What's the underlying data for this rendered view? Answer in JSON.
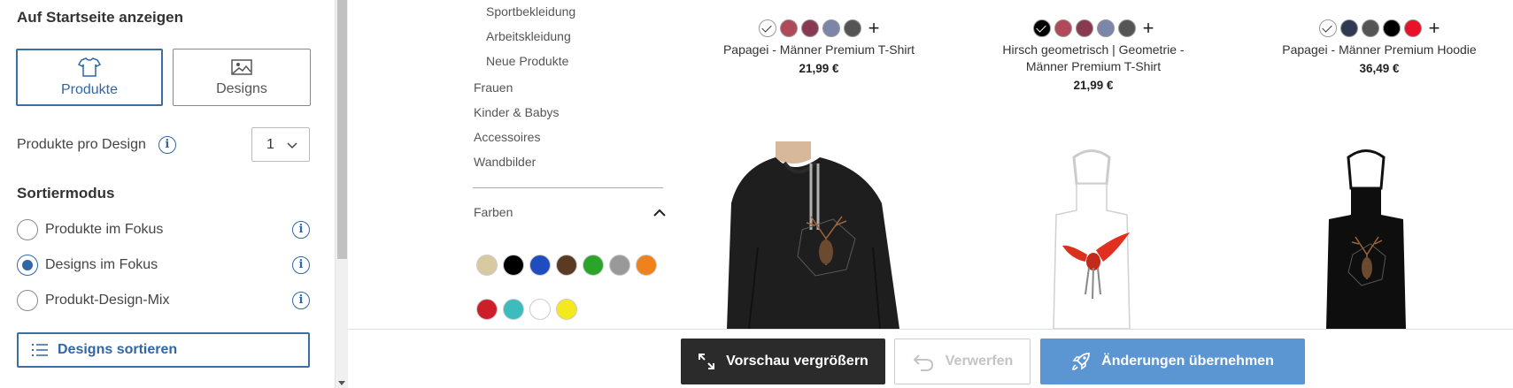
{
  "left": {
    "heading_home": "Auf Startseite anzeigen",
    "toggle": [
      {
        "label": "Produkte",
        "icon": "tshirt-icon",
        "active": true
      },
      {
        "label": "Designs",
        "icon": "image-icon",
        "active": false
      }
    ],
    "products_per_design_label": "Produkte pro Design",
    "products_per_design_value": "1",
    "sort_heading": "Sortiermodus",
    "sort_options": [
      {
        "label": "Produkte im Fokus",
        "selected": false
      },
      {
        "label": "Designs im Fokus",
        "selected": true
      },
      {
        "label": "Produkt-Design-Mix",
        "selected": false
      }
    ],
    "sort_button": "Designs sortieren"
  },
  "categories": {
    "sub": [
      "Sportbekleidung",
      "Arbeitskleidung",
      "Neue Produkte"
    ],
    "main": [
      "Frauen",
      "Kinder & Babys",
      "Accessoires",
      "Wandbilder"
    ],
    "colors_label": "Farben",
    "color_swatches": [
      "#d9c9a0",
      "#000000",
      "#1f4cbf",
      "#5a3a22",
      "#2aa52a",
      "#999999",
      "#f0821e",
      "#cc1f2a",
      "#3cbcbc",
      "#ffffff",
      "#f4e81f"
    ]
  },
  "products": [
    {
      "name": "Papagei - Männer Premium T-Shirt",
      "price": "21,99 €",
      "colors": [
        "#ffffff",
        "#b04a5a",
        "#8a3a50",
        "#7b86aa",
        "#555555"
      ],
      "selected_index": 0
    },
    {
      "name": "Hirsch geometrisch | Geometrie - Männer Premium T-Shirt",
      "price": "21,99 €",
      "colors": [
        "#000000",
        "#b04a5a",
        "#8a3a50",
        "#7b86aa",
        "#555555"
      ],
      "selected_index": 0
    },
    {
      "name": "Papagei - Männer Premium Hoodie",
      "price": "36,49 €",
      "colors": [
        "#ffffff",
        "#2f3a52",
        "#555555",
        "#000000",
        "#e8132a"
      ],
      "selected_index": 0
    }
  ],
  "actions": {
    "enlarge": "Vorschau vergrößern",
    "discard": "Verwerfen",
    "apply": "Änderungen übernehmen"
  }
}
